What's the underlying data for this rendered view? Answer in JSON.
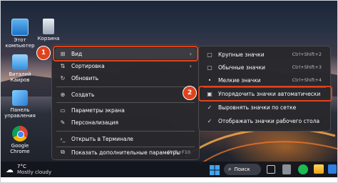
{
  "desktop": {
    "icons": [
      {
        "label": "Этот компьютер",
        "icon": "computer-icon"
      },
      {
        "label": "Корзина",
        "icon": "recycle-bin-icon"
      },
      {
        "label": "Виталий Каиров",
        "icon": "user-folder-icon"
      },
      {
        "label": "Панель управления",
        "icon": "control-panel-icon"
      },
      {
        "label": "Google Chrome",
        "icon": "chrome-icon"
      }
    ]
  },
  "context_menu": {
    "items": [
      {
        "label": "Вид",
        "icon": "grid-view-icon"
      },
      {
        "label": "Сортировка",
        "icon": "sort-icon"
      },
      {
        "label": "Обновить",
        "icon": "refresh-icon"
      },
      {
        "label": "Создать",
        "icon": "plus-icon"
      },
      {
        "label": "Параметры экрана",
        "icon": "display-icon"
      },
      {
        "label": "Персонализация",
        "icon": "brush-icon"
      },
      {
        "label": "Открыть в Терминале",
        "icon": "terminal-icon"
      },
      {
        "label": "Показать дополнительные параметры",
        "icon": "more-icon",
        "shortcut": "Shift+F10"
      }
    ]
  },
  "submenu": {
    "items": [
      {
        "label": "Крупные значки",
        "shortcut": "Ctrl+Shift+2"
      },
      {
        "label": "Обычные значки",
        "shortcut": "Ctrl+Shift+3"
      },
      {
        "label": "Мелкие значки",
        "shortcut": "Ctrl+Shift+4"
      },
      {
        "label": "Упорядочить значки автоматически"
      },
      {
        "label": "Выровнять значки по сетке"
      },
      {
        "label": "Отображать значки рабочего стола"
      }
    ]
  },
  "badges": {
    "one": "1",
    "two": "2"
  },
  "taskbar": {
    "weather_temp": "7°C",
    "weather_desc": "Mostly cloudy",
    "search_label": "Поиск"
  },
  "colors": {
    "accent": "#e0431c",
    "menu_bg": "#28282c"
  }
}
